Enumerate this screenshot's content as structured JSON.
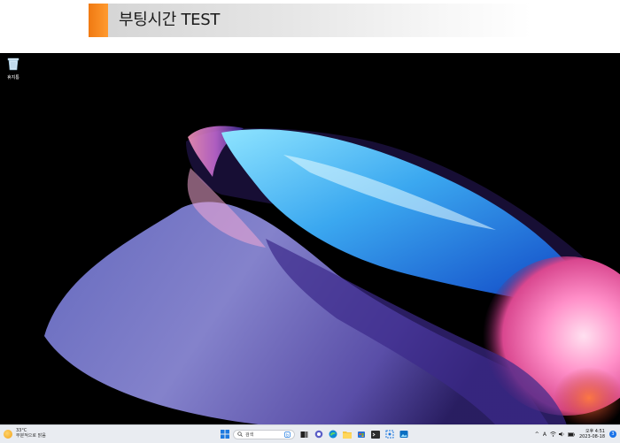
{
  "banner": {
    "title": "부팅시간 TEST"
  },
  "desktop": {
    "icons": [
      {
        "label": "휴지통",
        "icon": "recycle-bin-icon"
      }
    ]
  },
  "taskbar": {
    "weather": {
      "temp": "33°C",
      "condition": "부분적으로 맑음",
      "icon": "sun-icon"
    },
    "search": {
      "placeholder": "검색"
    },
    "pinned": [
      "start-icon",
      "search-icon",
      "copilot-icon",
      "task-view-icon",
      "chat-icon",
      "edge-icon",
      "file-explorer-icon",
      "store-icon",
      "snipping-tool-icon",
      "photos-icon"
    ],
    "tray": {
      "chevron": "^",
      "ime": "A"
    },
    "clock": {
      "time": "오후 4:51",
      "date": "2023-08-18"
    },
    "notification": {
      "count": "3"
    }
  },
  "colors": {
    "accent": "#f07a12",
    "taskbar": "#e9ecf1",
    "desktop": "#000000"
  }
}
